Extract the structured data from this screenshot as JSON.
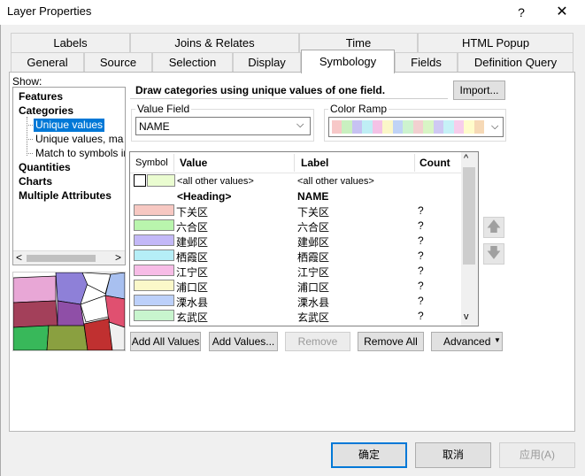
{
  "window": {
    "title": "Layer Properties",
    "help_glyph": "?",
    "close_glyph": "✕"
  },
  "tabs_row1": [
    "Labels",
    "Joins & Relates",
    "Time",
    "HTML Popup"
  ],
  "tabs_row2": [
    "General",
    "Source",
    "Selection",
    "Display",
    "Symbology",
    "Fields",
    "Definition Query"
  ],
  "active_tab": "Symbology",
  "show": {
    "label": "Show:",
    "tree": [
      {
        "label": "Features",
        "bold": true
      },
      {
        "label": "Categories",
        "bold": true
      },
      {
        "label": "Unique values",
        "selected": true
      },
      {
        "label": "Unique values, many"
      },
      {
        "label": "Match to symbols in a"
      },
      {
        "label": "Quantities",
        "bold": true
      },
      {
        "label": "Charts",
        "bold": true
      },
      {
        "label": "Multiple Attributes",
        "bold": true
      }
    ],
    "scroll_left": "<",
    "scroll_right": ">"
  },
  "main": {
    "heading": "Draw categories using unique values of one field.",
    "import_label": "Import...",
    "value_field": {
      "label": "Value Field",
      "value": "NAME"
    },
    "color_ramp": {
      "label": "Color Ramp",
      "colors": [
        "#f7c8c8",
        "#c9f0c0",
        "#c7c2f2",
        "#bfeef5",
        "#f4c2e6",
        "#fbf7c8",
        "#c0d3f6",
        "#cdf3cf",
        "#f2d0d0",
        "#d8f5c5",
        "#cfc9f3",
        "#c6f1f7",
        "#f7cdeb",
        "#fffccb",
        "#f6d9b6"
      ]
    },
    "table": {
      "headers": {
        "symbol": "Symbol",
        "value": "Value",
        "label": "Label",
        "count": "Count"
      },
      "other_values": {
        "value": "<all other values>",
        "label": "<all other values>"
      },
      "heading_row": {
        "value": "<Heading>",
        "label": "NAME"
      },
      "rows": [
        {
          "color": "#f7c8c2",
          "value": "下关区",
          "label": "下关区",
          "count": "?"
        },
        {
          "color": "#b9f5ad",
          "value": "六合区",
          "label": "六合区",
          "count": "?"
        },
        {
          "color": "#c3b8f7",
          "value": "建邺区",
          "label": "建邺区",
          "count": "?"
        },
        {
          "color": "#b5eef7",
          "value": "栖霞区",
          "label": "栖霞区",
          "count": "?"
        },
        {
          "color": "#f7bce6",
          "value": "江宁区",
          "label": "江宁区",
          "count": "?"
        },
        {
          "color": "#fbf8c9",
          "value": "浦口区",
          "label": "浦口区",
          "count": "?"
        },
        {
          "color": "#bcd0fa",
          "value": "溧水县",
          "label": "溧水县",
          "count": "?"
        },
        {
          "color": "#c8f5ce",
          "value": "玄武区",
          "label": "玄武区",
          "count": "?"
        }
      ]
    },
    "buttons": {
      "add_all": "Add All Values",
      "add_values": "Add Values...",
      "remove": "Remove",
      "remove_all": "Remove All",
      "advanced": "Advanced"
    },
    "arrow_up": "🡅",
    "arrow_down": "🡇"
  },
  "footer": {
    "ok": "确定",
    "cancel": "取消",
    "apply": "应用(A)"
  }
}
